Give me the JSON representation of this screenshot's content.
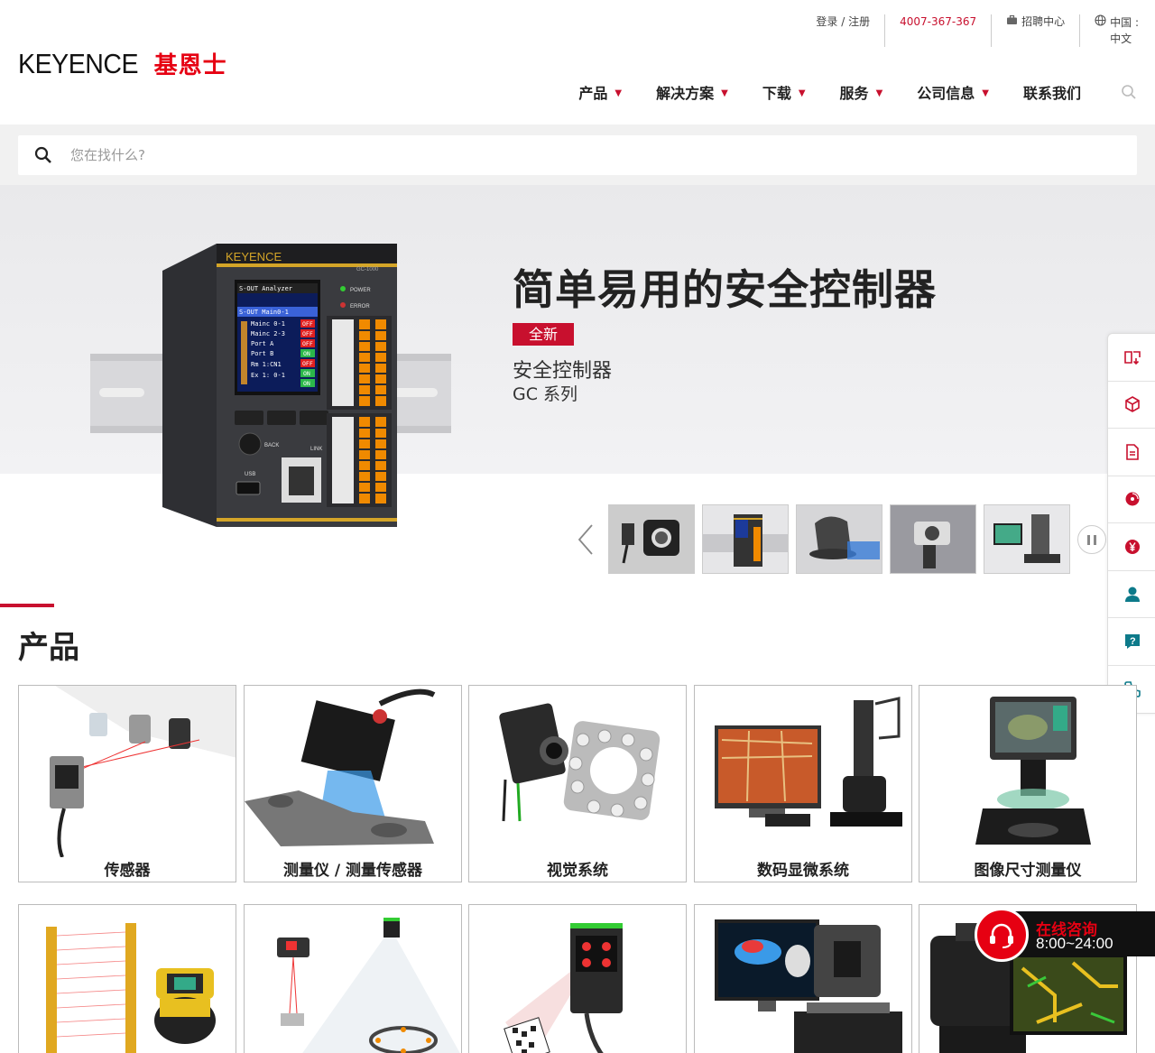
{
  "header": {
    "logo_en": "KEYENCE",
    "logo_cn": "基恩士",
    "utility": {
      "login": "登录 / 注册",
      "phone": "4007-367-367",
      "careers": "招聘中心",
      "region": "中国 :",
      "language": "中文"
    },
    "nav": [
      "产品",
      "解决方案",
      "下载",
      "服务",
      "公司信息",
      "联系我们"
    ]
  },
  "search": {
    "placeholder": "您在找什么?"
  },
  "hero": {
    "title": "简单易用的安全控制器",
    "badge": "全新",
    "subtitle": "安全控制器",
    "series": "GC 系列",
    "device_brand": "KEYENCE",
    "device_model": "GC-1000",
    "screen_lines": [
      "S-OUT Analyzer",
      "S-OUT Main0-1",
      "Mainc 0-1",
      "Mainc 2-3",
      "Port A",
      "Port B",
      "Rm 1:CN1",
      "Ex 1: 0-1"
    ],
    "screen_status": [
      "OFF",
      "OFF",
      "OFF",
      "ON",
      "OFF",
      "ON",
      "ON"
    ],
    "device_labels": {
      "power": "POWER",
      "error": "ERROR",
      "back": "BACK",
      "usb": "USB",
      "link": "LINK"
    }
  },
  "products": {
    "section_title": "产品",
    "items": [
      "传感器",
      "测量仪 / 测量传感器",
      "视觉系统",
      "数码显微系统",
      "图像尺寸测量仪",
      "",
      "",
      "",
      "",
      ""
    ]
  },
  "chat": {
    "title": "在线咨询",
    "hours": "8:00~24:00"
  },
  "colors": {
    "brand_red": "#c8102e",
    "accent_orange": "#f08a00"
  }
}
